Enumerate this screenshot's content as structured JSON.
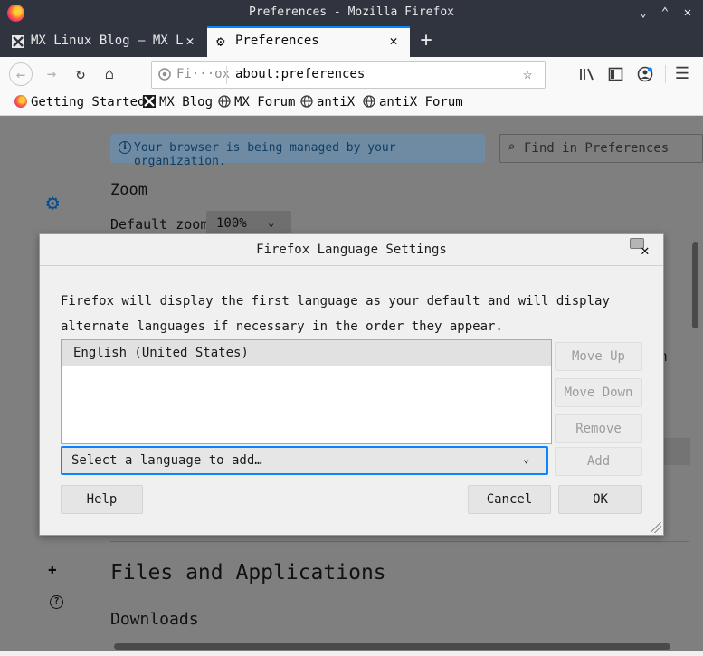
{
  "window": {
    "title": "Preferences - Mozilla Firefox"
  },
  "tabs": [
    {
      "label": "MX Linux Blog – MX Linux",
      "active": false
    },
    {
      "label": "Preferences",
      "active": true
    }
  ],
  "navbar": {
    "identity_label": "Fi···ox",
    "url": "about:preferences"
  },
  "bookmarks": [
    {
      "label": "Getting Started",
      "icon": "firefox-icon"
    },
    {
      "label": "MX Blog",
      "icon": "mx-logo-icon"
    },
    {
      "label": "MX Forum",
      "icon": "globe-icon"
    },
    {
      "label": "antiX",
      "icon": "globe-icon"
    },
    {
      "label": "antiX Forum",
      "icon": "globe-icon"
    }
  ],
  "page": {
    "managed_notice": "Your browser is being managed by your organization.",
    "find_placeholder": "Find in Preferences",
    "zoom_heading": "Zoom",
    "default_zoom_label": "Default zoom",
    "zoom_value": "100%",
    "files_heading": "Files and Applications",
    "downloads_heading": "Downloads",
    "ghost_text": "m"
  },
  "dialog": {
    "title": "Firefox Language Settings",
    "description": "Firefox will display the first language as your default and will display alternate languages if necessary in the order they appear.",
    "languages": [
      "English (United States)"
    ],
    "buttons": {
      "move_up": "Move Up",
      "move_down": "Move Down",
      "remove": "Remove",
      "add": "Add",
      "help": "Help",
      "cancel": "Cancel",
      "ok": "OK"
    },
    "select_placeholder": "Select a language to add…"
  },
  "colors": {
    "accent": "#0a84ff",
    "titlebar": "#2f343f"
  }
}
